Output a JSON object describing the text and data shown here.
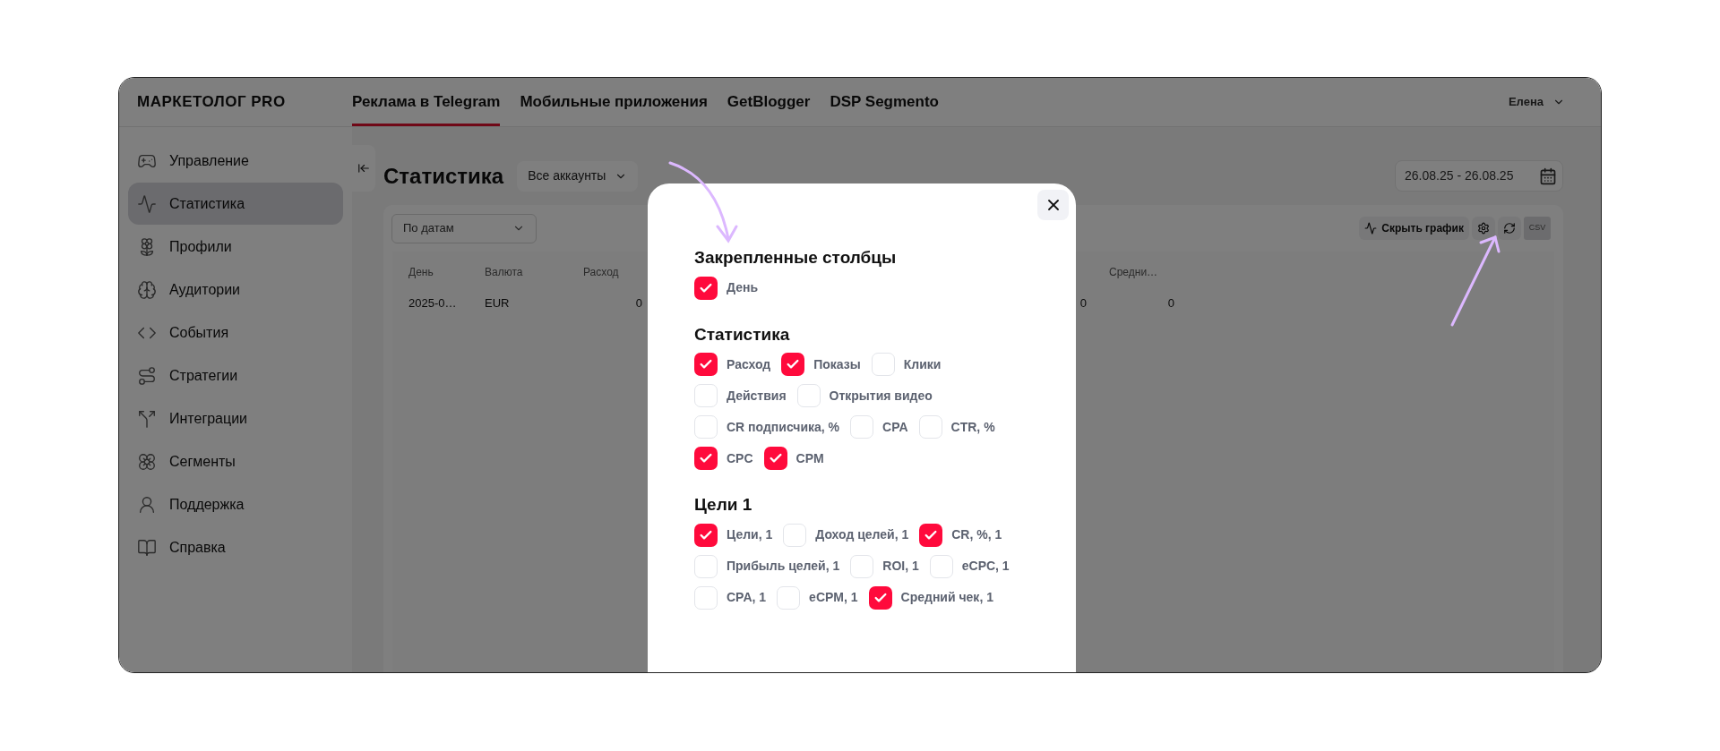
{
  "brand": "МАРКЕТОЛОГ PRO",
  "nav_tabs": [
    {
      "label": "Реклама в Telegram",
      "selected": true
    },
    {
      "label": "Мобильные приложения",
      "selected": false
    },
    {
      "label": "GetBlogger",
      "selected": false
    },
    {
      "label": "DSP Segmento",
      "selected": false
    }
  ],
  "user": {
    "name": "Елена"
  },
  "sidebar": {
    "items": [
      {
        "label": "Управление",
        "selected": false
      },
      {
        "label": "Статистика",
        "selected": true
      },
      {
        "label": "Профили",
        "selected": false
      },
      {
        "label": "Аудитории",
        "selected": false
      },
      {
        "label": "События",
        "selected": false
      },
      {
        "label": "Стратегии",
        "selected": false
      },
      {
        "label": "Интеграции",
        "selected": false
      },
      {
        "label": "Сегменты",
        "selected": false
      },
      {
        "label": "Поддержка",
        "selected": false
      },
      {
        "label": "Справка",
        "selected": false
      }
    ]
  },
  "page": {
    "title": "Статистика",
    "account_select": {
      "value": "Все аккаунты"
    },
    "date_range": {
      "value": "26.08.25 - 26.08.25"
    }
  },
  "toolbar": {
    "group_select": {
      "value": "По датам"
    },
    "hide_chart_button": "Скрыть график",
    "export_label": "CSV"
  },
  "table": {
    "columns": [
      "День",
      "Валюта",
      "Расход",
      "Средни…"
    ],
    "rows": [
      {
        "cells": [
          "2025-0…",
          "EUR",
          "0",
          "0",
          "0"
        ]
      }
    ]
  },
  "modal": {
    "sections": [
      {
        "title": "Закрепленные столбцы",
        "rows": [
          [
            {
              "label": "День",
              "checked": true
            }
          ]
        ]
      },
      {
        "title": "Статистика",
        "rows": [
          [
            {
              "label": "Расход",
              "checked": true
            },
            {
              "label": "Показы",
              "checked": true
            },
            {
              "label": "Клики",
              "checked": false
            }
          ],
          [
            {
              "label": "Действия",
              "checked": false
            },
            {
              "label": "Открытия видео",
              "checked": false
            }
          ],
          [
            {
              "label": "CR подписчика, %",
              "checked": false
            },
            {
              "label": "CPA",
              "checked": false
            },
            {
              "label": "CTR, %",
              "checked": false
            }
          ],
          [
            {
              "label": "CPC",
              "checked": true
            },
            {
              "label": "CPM",
              "checked": true
            }
          ]
        ]
      },
      {
        "title": "Цели 1",
        "rows": [
          [
            {
              "label": "Цели, 1",
              "checked": true
            },
            {
              "label": "Доход целей, 1",
              "checked": false
            },
            {
              "label": "CR, %, 1",
              "checked": true
            }
          ],
          [
            {
              "label": "Прибыль целей, 1",
              "checked": false
            },
            {
              "label": "ROI, 1",
              "checked": false
            },
            {
              "label": "eCPC, 1",
              "checked": false
            }
          ],
          [
            {
              "label": "CPA, 1",
              "checked": false
            },
            {
              "label": "eCPM, 1",
              "checked": false
            },
            {
              "label": "Средний чек, 1",
              "checked": true
            }
          ]
        ]
      }
    ]
  }
}
